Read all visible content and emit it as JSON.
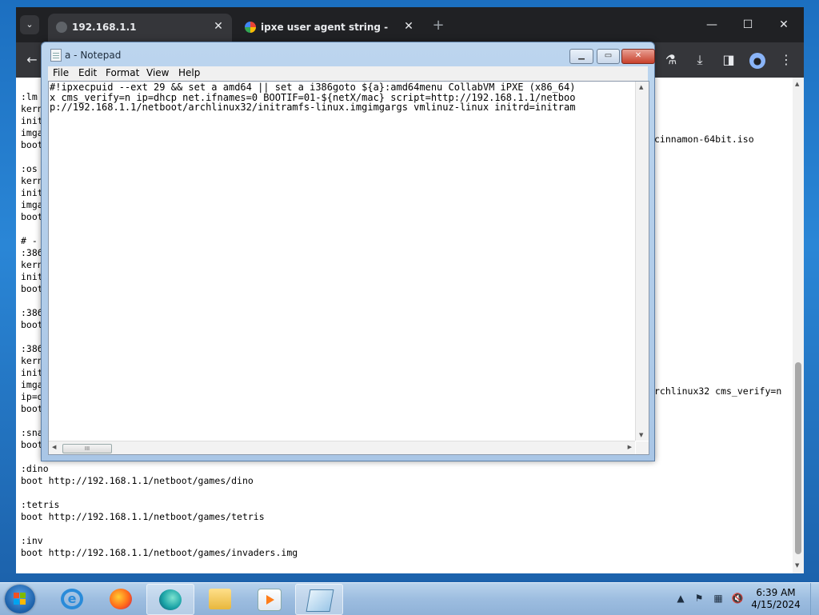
{
  "browser": {
    "tabs": [
      {
        "title": "192.168.1.1",
        "active": true
      },
      {
        "title": "ipxe user agent string - Google",
        "active": false
      }
    ],
    "new_tab_symbol": "+",
    "tab_close_symbol": "✕",
    "window_controls": {
      "minimize": "—",
      "maximize": "☐",
      "close": "✕"
    },
    "toolbar_icons": [
      "back-arrow-icon",
      "labs-flask-icon",
      "download-icon",
      "side-panel-icon",
      "profile-icon",
      "more-menu-icon"
    ],
    "page_lines": [
      "",
      ":lm",
      "kern",
      "init",
      "imga",
      "boot",
      "",
      ":os",
      "kern",
      "init",
      "imga",
      "boot",
      "",
      "# -",
      ":386",
      "kern",
      "init",
      "boot",
      "",
      ":386",
      "boot",
      "",
      ":386",
      "kern",
      "init",
      "imga",
      "ip=d",
      "boot",
      "",
      ":sna",
      "boot",
      "",
      ":dino",
      "boot http://192.168.1.1/netboot/games/dino",
      "",
      ":tetris",
      "boot http://192.168.1.1/netboot/games/tetris",
      "",
      ":inv",
      "boot http://192.168.1.1/netboot/games/invaders.img"
    ],
    "overflow_text_1": "cinnamon-64bit.iso",
    "overflow_text_2": "rchlinux32 cms_verify=n"
  },
  "notepad": {
    "title": "a - Notepad",
    "menu": [
      "File",
      "Edit",
      "Format",
      "View",
      "Help"
    ],
    "lines": [
      "#!ipxecpuid --ext 29 && set a amd64 || set a i386goto ${a}:amd64menu CollabVM iPXE (x86_64)",
      "x cms_verify=n ip=dhcp net.ifnames=0 BOOTIF=01-${netX/mac} script=http://192.168.1.1/netboo",
      "p://192.168.1.1/netboot/archlinux32/initramfs-linux.imgimgargs vmlinuz-linux initrd=initram"
    ],
    "scroll_grip": "III"
  },
  "taskbar": {
    "apps": [
      "internet-explorer",
      "firefox",
      "edge-browser",
      "file-explorer",
      "media-player",
      "notepad"
    ],
    "clock_time": "6:39 AM",
    "clock_date": "4/15/2024",
    "ie_letter": "e"
  }
}
